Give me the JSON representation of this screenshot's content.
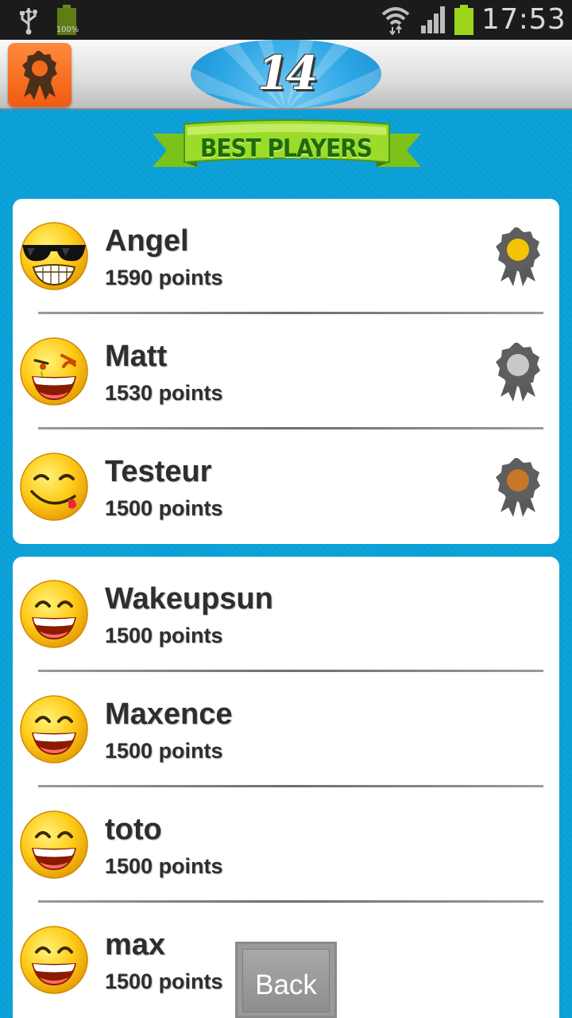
{
  "status_bar": {
    "battery_left_label": "100%",
    "time": "17:53",
    "icons": [
      "usb-icon",
      "battery-icon",
      "wifi-icon",
      "signal-icon",
      "battery-icon"
    ]
  },
  "header": {
    "logo_text": "14",
    "award_button_icon": "award-icon"
  },
  "banner": {
    "title": "BEST PLAYERS"
  },
  "top_players": [
    {
      "name": "Angel",
      "points": "1590 points",
      "medal": "gold",
      "avatar": "sunglasses-smiley"
    },
    {
      "name": "Matt",
      "points": "1530 points",
      "medal": "silver",
      "avatar": "winking-smiley"
    },
    {
      "name": "Testeur",
      "points": "1500 points",
      "medal": "bronze",
      "avatar": "tongue-smiley"
    }
  ],
  "other_players": [
    {
      "name": "Wakeupsun",
      "points": "1500 points",
      "avatar": "grinning-smiley"
    },
    {
      "name": "Maxence",
      "points": "1500 points",
      "avatar": "grinning-smiley"
    },
    {
      "name": "toto",
      "points": "1500 points",
      "avatar": "grinning-smiley"
    },
    {
      "name": "max",
      "points": "1500 points",
      "avatar": "grinning-smiley"
    }
  ],
  "back_button": {
    "label": "Back"
  },
  "colors": {
    "background": "#0a9fd6",
    "award_button": "#f26b1d",
    "banner_green": "#8fd11e",
    "medal_gold": "#f5c400",
    "medal_silver": "#c8c8c8",
    "medal_bronze": "#c8762a"
  }
}
